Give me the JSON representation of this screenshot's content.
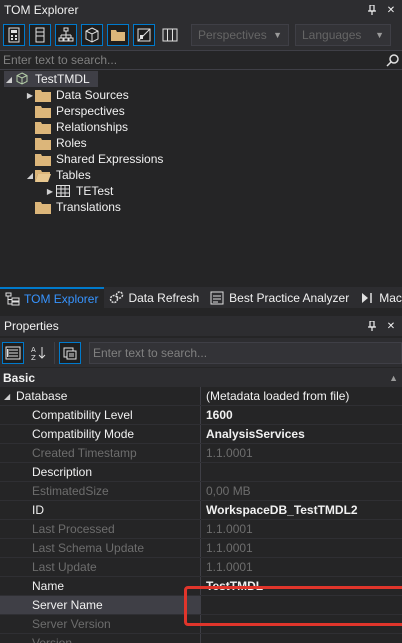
{
  "tom_explorer": {
    "title": "TOM Explorer",
    "toolbar": {
      "perspectives_placeholder": "Perspectives",
      "languages_placeholder": "Languages"
    },
    "search_placeholder": "Enter text to search...",
    "tree": {
      "root": "TestTMDL",
      "items": [
        {
          "label": "Data Sources",
          "expandable": true
        },
        {
          "label": "Perspectives",
          "expandable": false
        },
        {
          "label": "Relationships",
          "expandable": false
        },
        {
          "label": "Roles",
          "expandable": false
        },
        {
          "label": "Shared Expressions",
          "expandable": false
        },
        {
          "label": "Tables",
          "expandable": true,
          "expanded": true
        },
        {
          "label": "TETest",
          "expandable": true,
          "child": true,
          "icon": "table-icon"
        },
        {
          "label": "Translations",
          "expandable": false
        }
      ]
    },
    "tabs": [
      {
        "label": "TOM Explorer",
        "active": true
      },
      {
        "label": "Data Refresh",
        "active": false
      },
      {
        "label": "Best Practice Analyzer",
        "active": false
      },
      {
        "label": "Macro",
        "active": false
      }
    ]
  },
  "properties": {
    "title": "Properties",
    "search_placeholder": "Enter text to search...",
    "category": "Basic",
    "rows": [
      {
        "name": "Database",
        "value": "(Metadata loaded from file)",
        "group": true
      },
      {
        "name": "Compatibility Level",
        "value": "1600",
        "bold": true
      },
      {
        "name": "Compatibility Mode",
        "value": "AnalysisServices",
        "bold": true
      },
      {
        "name": "Created Timestamp",
        "value": "1.1.0001",
        "dim": true
      },
      {
        "name": "Description",
        "value": ""
      },
      {
        "name": "EstimatedSize",
        "value": "0,00 MB",
        "dim": true
      },
      {
        "name": "ID",
        "value": "WorkspaceDB_TestTMDL2",
        "bold": true
      },
      {
        "name": "Last Processed",
        "value": "1.1.0001",
        "dim": true
      },
      {
        "name": "Last Schema Update",
        "value": "1.1.0001",
        "dim": true
      },
      {
        "name": "Last Update",
        "value": "1.1.0001",
        "dim": true
      },
      {
        "name": "Name",
        "value": "TestTMDL",
        "bold": true
      },
      {
        "name": "Server Name",
        "value": "",
        "selected": true
      },
      {
        "name": "Server Version",
        "value": "",
        "dim": true
      },
      {
        "name": "Version",
        "value": "",
        "dim": true
      }
    ]
  },
  "colors": {
    "accent": "#007acc",
    "highlight_box": "#e0352b",
    "folder": "#dcb67a"
  }
}
